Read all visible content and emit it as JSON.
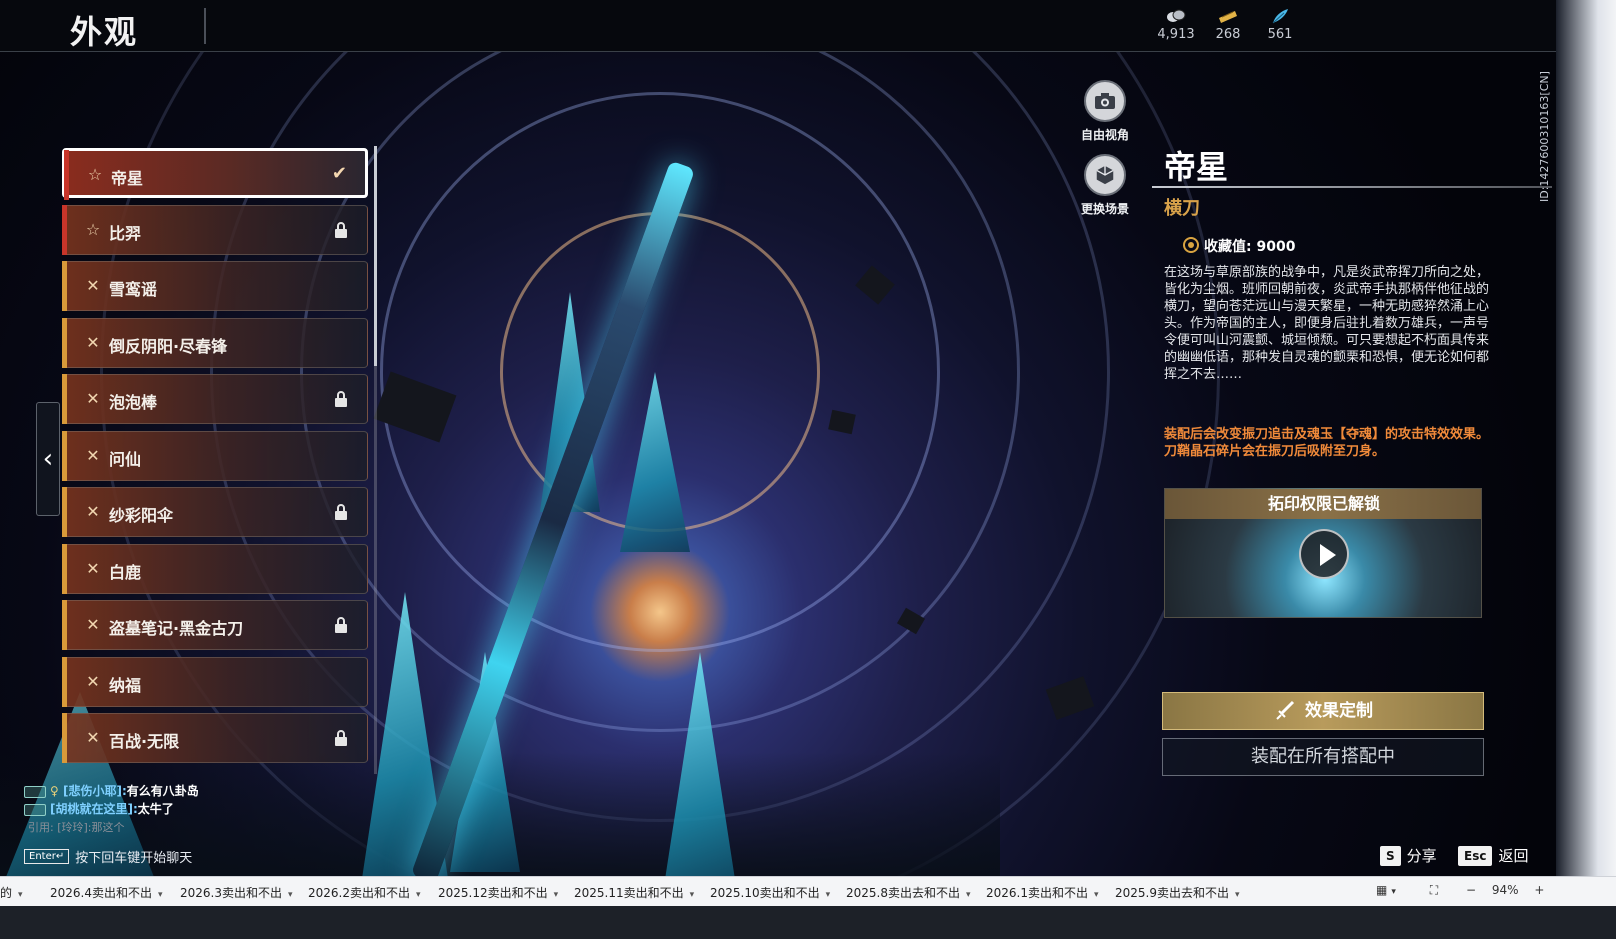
{
  "header": {
    "title": "外观",
    "currencies": [
      {
        "icon": "coin-stack-icon",
        "value": "4,913"
      },
      {
        "icon": "gold-ticket-icon",
        "value": "268"
      },
      {
        "icon": "feather-icon",
        "value": "561"
      }
    ]
  },
  "side_id": "ID:1427600310163[CN]",
  "skin_list": [
    {
      "name": "帝星",
      "rarity": "red",
      "selected": true,
      "locked": false
    },
    {
      "name": "比羿",
      "rarity": "red",
      "selected": false,
      "locked": true
    },
    {
      "name": "雪鸾谣",
      "rarity": "gold",
      "selected": false,
      "locked": false
    },
    {
      "name": "倒反阴阳·尽春锋",
      "rarity": "gold",
      "selected": false,
      "locked": false
    },
    {
      "name": "泡泡棒",
      "rarity": "gold",
      "selected": false,
      "locked": true
    },
    {
      "name": "问仙",
      "rarity": "gold",
      "selected": false,
      "locked": false
    },
    {
      "name": "纱彩阳伞",
      "rarity": "gold",
      "selected": false,
      "locked": true
    },
    {
      "name": "白鹿",
      "rarity": "gold",
      "selected": false,
      "locked": false
    },
    {
      "name": "盗墓笔记·黑金古刀",
      "rarity": "gold",
      "selected": false,
      "locked": true
    },
    {
      "name": "纳福",
      "rarity": "gold",
      "selected": false,
      "locked": false
    },
    {
      "name": "百战·无限",
      "rarity": "gold",
      "selected": false,
      "locked": true
    }
  ],
  "view_buttons": {
    "free_view": "自由视角",
    "change_scene": "更换场景"
  },
  "detail": {
    "name": "帝星",
    "type": "横刀",
    "collection": "收藏值: 9000",
    "description": "在这场与草原部族的战争中，凡是炎武帝挥刀所向之处，皆化为尘烟。班师回朝前夜，炎武帝手执那柄伴他征战的横刀，望向苍茫远山与漫天繁星，一种无助感猝然涌上心头。作为帝国的主人，即便身后驻扎着数万雄兵，一声号令便可叫山河震颤、城垣倾颓。可只要想起不朽面具传来的幽幽低语，那种发自灵魂的颤栗和恐惧，便无论如何都挥之不去……",
    "effect_1": "装配后会改变振刀追击及魂玉【夺魂】的攻击特效效果。",
    "effect_2": "刀鞘晶石碎片会在振刀后吸附至刀身。",
    "video_title": "拓印权限已解锁",
    "customize_button": "效果定制",
    "equip_button": "装配在所有搭配中"
  },
  "chat": [
    {
      "name": "[悲伤小耶]:",
      "message": "有么有八卦岛"
    },
    {
      "name": "[胡桃就在这里]:",
      "message": "太牛了"
    }
  ],
  "chat_quote": "引用: [玲玲]:那这个",
  "enter_hint": {
    "key": "Enter↵",
    "text": "按下回车键开始聊天"
  },
  "hints": [
    {
      "key": "S",
      "label": "分享"
    },
    {
      "key": "Esc",
      "label": "返回"
    }
  ],
  "taskbar": {
    "tabs": [
      "的",
      "2026.4卖出和不出",
      "2026.3卖出和不出",
      "2026.2卖出和不出",
      "2025.12卖出和不出",
      "2025.11卖出和不出",
      "2025.10卖出和不出",
      "2025.8卖出去和不出",
      "2026.1卖出和不出",
      "2025.9卖出去和不出"
    ],
    "zoom": "94%"
  }
}
